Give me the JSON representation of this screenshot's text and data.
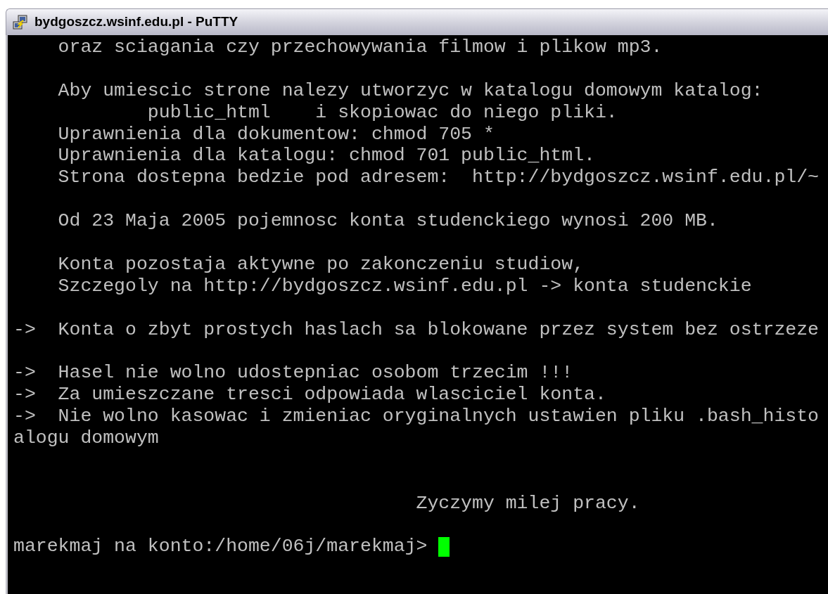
{
  "window": {
    "title": "bydgoszcz.wsinf.edu.pl - PuTTY"
  },
  "terminal": {
    "lines": [
      {
        "kind": "text",
        "text": "    oraz sciagania czy przechowywania filmow i plikow mp3."
      },
      {
        "kind": "blank"
      },
      {
        "kind": "text",
        "text": "    Aby umiescic strone nalezy utworzyc w katalogu domowym katalog:"
      },
      {
        "kind": "text",
        "text": "            public_html    i skopiowac do niego pliki."
      },
      {
        "kind": "text",
        "text": "    Uprawnienia dla dokumentow: chmod 705 *"
      },
      {
        "kind": "text",
        "text": "    Uprawnienia dla katalogu: chmod 701 public_html."
      },
      {
        "kind": "text",
        "text": "    Strona dostepna bedzie pod adresem:  http://bydgoszcz.wsinf.edu.pl/~"
      },
      {
        "kind": "blank"
      },
      {
        "kind": "text",
        "text": "    Od 23 Maja 2005 pojemnosc konta studenckiego wynosi 200 MB."
      },
      {
        "kind": "blank"
      },
      {
        "kind": "text",
        "text": "    Konta pozostaja aktywne po zakonczeniu studiow,"
      },
      {
        "kind": "text",
        "text": "    Szczegoly na http://bydgoszcz.wsinf.edu.pl -> konta studenckie"
      },
      {
        "kind": "blank"
      },
      {
        "kind": "text",
        "text": "->  Konta o zbyt prostych haslach sa blokowane przez system bez ostrzeze"
      },
      {
        "kind": "blank"
      },
      {
        "kind": "text",
        "text": "->  Hasel nie wolno udostepniac osobom trzecim !!!"
      },
      {
        "kind": "text",
        "text": "->  Za umieszczane tresci odpowiada wlasciciel konta."
      },
      {
        "kind": "text",
        "text": "->  Nie wolno kasowac i zmieniac oryginalnych ustawien pliku .bash_histo"
      },
      {
        "kind": "text",
        "text": "alogu domowym"
      },
      {
        "kind": "blank"
      },
      {
        "kind": "blank"
      },
      {
        "kind": "text",
        "text": "                                    Zyczymy milej pracy."
      },
      {
        "kind": "blank"
      }
    ],
    "prompt": {
      "text": "marekmaj na konto:/home/06j/marekmaj> ",
      "cursor_visible": true
    }
  }
}
